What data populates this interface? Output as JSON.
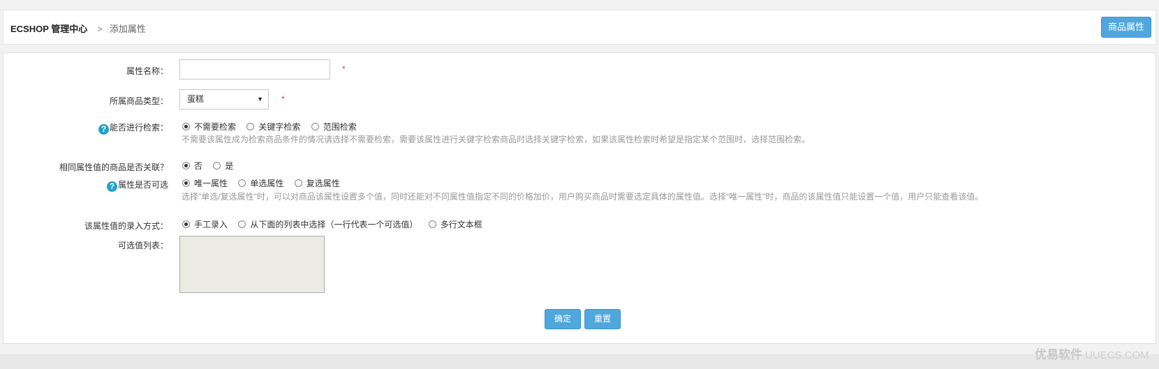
{
  "breadcrumb": {
    "home": "ECSHOP 管理中心",
    "separator": ">",
    "current": "添加属性"
  },
  "header": {
    "attr_button": "商品属性"
  },
  "form": {
    "attr_name": {
      "label": "属性名称：",
      "value": "",
      "required": "*"
    },
    "goods_type": {
      "label": "所属商品类型：",
      "selected": "蛋糕",
      "required": "*"
    },
    "index_type": {
      "label": "能否进行检索：",
      "options": [
        "不需要检索",
        "关键字检索",
        "范围检索"
      ],
      "selected_index": 0,
      "hint": "不需要该属性成为检索商品条件的情况请选择不需要检索，需要该属性进行关键字检索商品时选择关键字检索，如果该属性检索时希望是指定某个范围时，选择范围检索。"
    },
    "is_linked": {
      "label": "相同属性值的商品是否关联？",
      "options": [
        "否",
        "是"
      ],
      "selected_index": 0
    },
    "attr_type": {
      "label": "属性是否可选",
      "options": [
        "唯一属性",
        "单选属性",
        "复选属性"
      ],
      "selected_index": 0,
      "hint": "选择\"单选/复选属性\"时，可以对商品该属性设置多个值，同时还能对不同属性值指定不同的价格加价，用户购买商品时需要选定具体的属性值。选择\"唯一属性\"时，商品的该属性值只能设置一个值，用户只能查看该值。"
    },
    "input_type": {
      "label": "该属性值的录入方式：",
      "options": [
        "手工录入",
        "从下面的列表中选择（一行代表一个可选值）",
        "多行文本框"
      ],
      "selected_index": 0
    },
    "values": {
      "label": "可选值列表：",
      "value": ""
    }
  },
  "buttons": {
    "submit": "确定",
    "reset": "重置"
  },
  "watermark": {
    "cn": "优易软件",
    "en": "UUECS.COM"
  },
  "colors": {
    "accent": "#4fa7dd",
    "help": "#1fa3c6",
    "required": "#e33"
  }
}
